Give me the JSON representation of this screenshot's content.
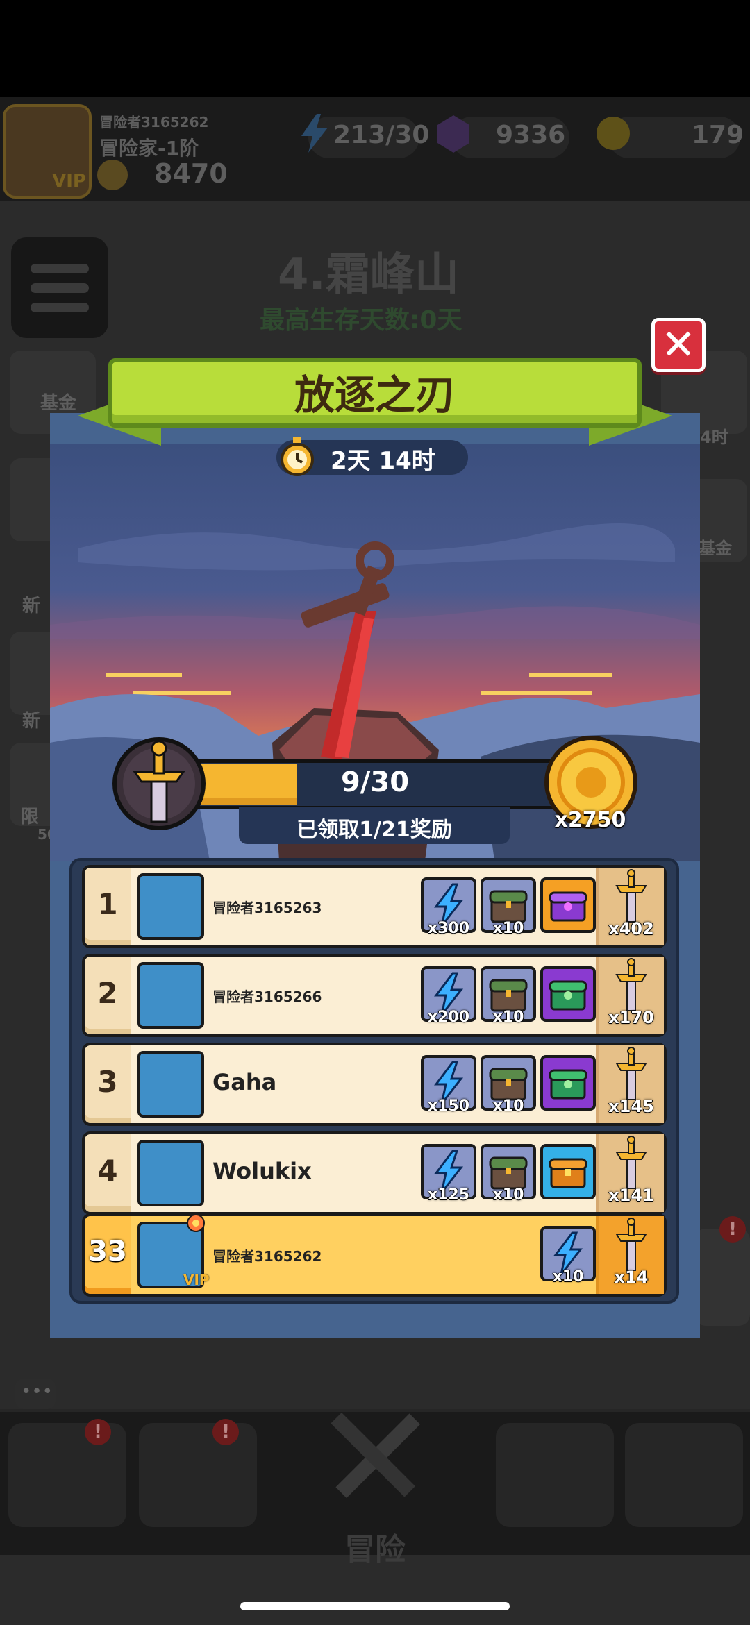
{
  "background": {
    "player": {
      "name": "冒险者3165262",
      "rank": "冒险家-1阶",
      "power": "8470",
      "vip": "VIP"
    },
    "resources": [
      {
        "icon": "energy-icon",
        "value": "213/30"
      },
      {
        "icon": "gem-icon",
        "value": "9336"
      },
      {
        "icon": "coin-icon",
        "value": "179"
      }
    ],
    "stage": {
      "title": "4.霜峰山",
      "subtitle": "最高生存天数:0天"
    },
    "side_labels": {
      "left_fund": "基金",
      "left_new1": "新",
      "left_new2": "新",
      "left_bottom": "限",
      "left_number": "50",
      "right_time": "4时",
      "right_fund": "基金"
    },
    "bottom_nav": {
      "adventure_label": "冒险",
      "badge": "!"
    }
  },
  "modal": {
    "title": "放逐之刃",
    "close_label": "✕",
    "timer": "2天 14时",
    "progress": {
      "current": 9,
      "total": 30,
      "text": "9/30",
      "fraction": 0.3
    },
    "claimed_text": "已领取1/21奖励",
    "reward_coin_amount": "x2750",
    "colors": {
      "accent": "#b8dd3a",
      "panel": "#46648f",
      "highlight_row": "#ffc34a"
    },
    "leaderboard": [
      {
        "rank": "1",
        "name": "冒险者3165263",
        "name_size": "small",
        "items": [
          {
            "type": "energy",
            "qty": "x300"
          },
          {
            "type": "chest",
            "qty": "x10"
          },
          {
            "type": "epic",
            "qty": ""
          }
        ],
        "swords": "x402"
      },
      {
        "rank": "2",
        "name": "冒险者3165266",
        "name_size": "small",
        "items": [
          {
            "type": "energy",
            "qty": "x200"
          },
          {
            "type": "chest",
            "qty": "x10"
          },
          {
            "type": "purple",
            "qty": ""
          }
        ],
        "swords": "x170"
      },
      {
        "rank": "3",
        "name": "Gaha",
        "name_size": "big",
        "items": [
          {
            "type": "energy",
            "qty": "x150"
          },
          {
            "type": "chest",
            "qty": "x10"
          },
          {
            "type": "purple",
            "qty": ""
          }
        ],
        "swords": "x145"
      },
      {
        "rank": "4",
        "name": "Wolukix",
        "name_size": "big",
        "items": [
          {
            "type": "energy",
            "qty": "x125"
          },
          {
            "type": "chest",
            "qty": "x10"
          },
          {
            "type": "blue",
            "qty": ""
          }
        ],
        "swords": "x141"
      }
    ],
    "me": {
      "rank": "33",
      "name": "冒险者3165262",
      "vip": "VIP",
      "items": [
        {
          "type": "energy",
          "qty": "x10"
        }
      ],
      "swords": "x14"
    }
  }
}
